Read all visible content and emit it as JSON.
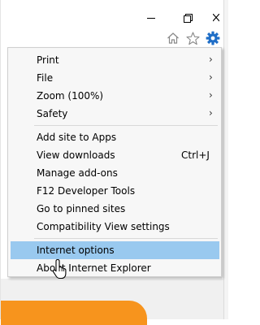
{
  "window_controls": {
    "minimize_icon": "minimize-icon",
    "restore_icon": "restore-icon",
    "close_icon": "close-icon"
  },
  "toolbar": {
    "home_icon": "home-icon",
    "favorites_icon": "star-icon",
    "tools_icon": "gear-icon",
    "accent_color": "#1f6ec7"
  },
  "menu": {
    "items": [
      {
        "label": "Print",
        "has_submenu": true
      },
      {
        "label": "File",
        "has_submenu": true
      },
      {
        "label": "Zoom (100%)",
        "has_submenu": true
      },
      {
        "label": "Safety",
        "has_submenu": true
      },
      {
        "label": "Add site to Apps"
      },
      {
        "label": "View downloads",
        "shortcut": "Ctrl+J"
      },
      {
        "label": "Manage add-ons"
      },
      {
        "label": "F12 Developer Tools"
      },
      {
        "label": "Go to pinned sites"
      },
      {
        "label": "Compatibility View settings"
      },
      {
        "label": "Internet options",
        "highlighted": true
      },
      {
        "label": "About Internet Explorer"
      }
    ],
    "submenu_arrow": "›",
    "highlight_color": "#99c9ef"
  },
  "page_background": {
    "accent_color": "#f7941d"
  }
}
